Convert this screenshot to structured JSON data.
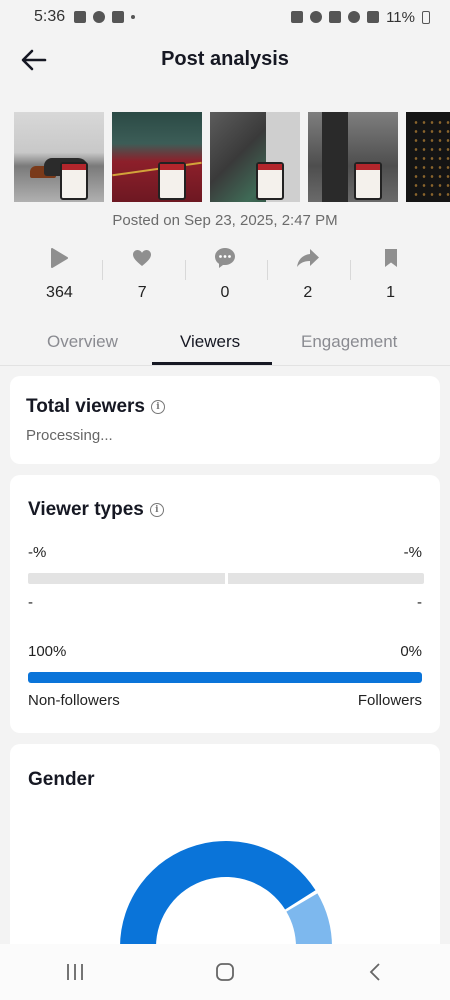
{
  "status_bar": {
    "time": "5:36",
    "battery": "11%"
  },
  "header": {
    "title": "Post analysis"
  },
  "posted_on": "Posted on Sep 23, 2025, 2:47 PM",
  "stats": [
    {
      "icon": "play-icon",
      "value": "364"
    },
    {
      "icon": "heart-icon",
      "value": "7"
    },
    {
      "icon": "comment-icon",
      "value": "0"
    },
    {
      "icon": "share-icon",
      "value": "2"
    },
    {
      "icon": "bookmark-icon",
      "value": "1"
    }
  ],
  "tabs": [
    {
      "label": "Overview",
      "active": false
    },
    {
      "label": "Viewers",
      "active": true
    },
    {
      "label": "Engagement",
      "active": false
    }
  ],
  "total_viewers": {
    "title": "Total viewers",
    "status": "Processing..."
  },
  "viewer_types": {
    "title": "Viewer types",
    "row1": {
      "left_pct": "-%",
      "right_pct": "-%",
      "left_label": "-",
      "right_label": "-"
    },
    "row2": {
      "left_pct": "100%",
      "right_pct": "0%",
      "left_label": "Non-followers",
      "right_label": "Followers",
      "fill_fraction": 1.0
    }
  },
  "gender": {
    "title": "Gender",
    "segments": [
      {
        "color": "#0a74d9",
        "fraction": 0.82
      },
      {
        "color": "#7db8ee",
        "fraction": 0.18
      }
    ]
  },
  "colors": {
    "accent_blue": "#0a74d9",
    "light_blue": "#7db8ee"
  }
}
